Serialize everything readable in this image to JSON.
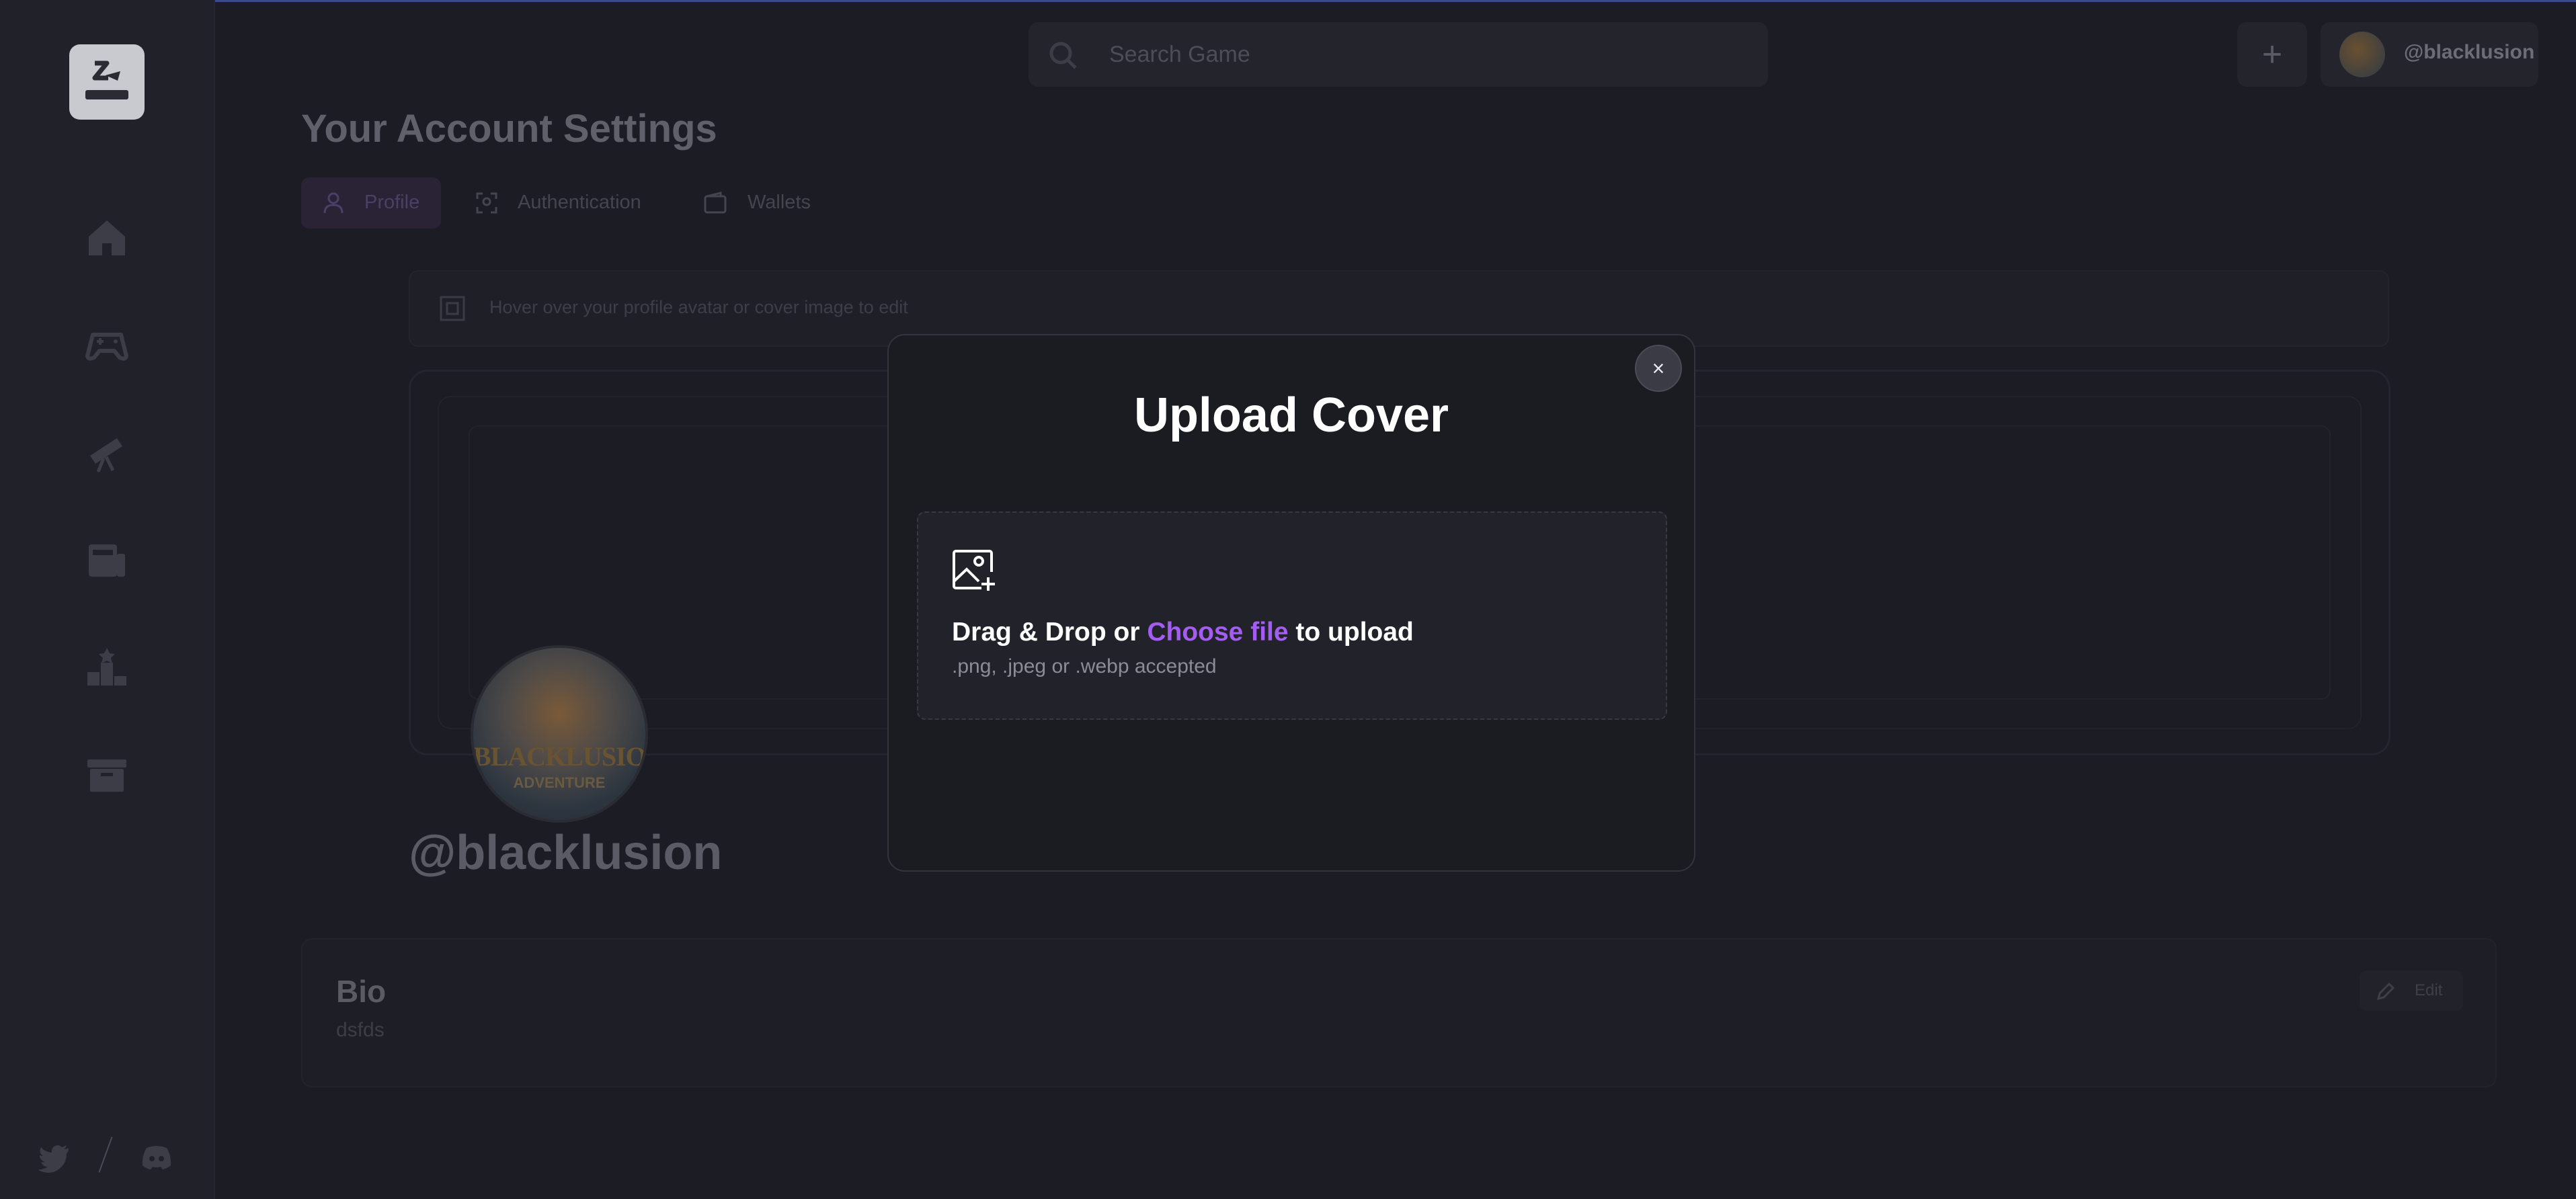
{
  "header": {
    "search_placeholder": "Search Game",
    "add_label": "+",
    "username": "@blacklusion"
  },
  "page": {
    "title": "Your Account Settings",
    "tabs": [
      {
        "label": "Profile",
        "active": true
      },
      {
        "label": "Authentication",
        "active": false
      },
      {
        "label": "Wallets",
        "active": false
      }
    ],
    "hint": "Hover over your profile avatar or cover image to edit",
    "avatar_brand": "BLACKLUSION",
    "avatar_sub": "ADVENTURE",
    "profile_name": "@blacklusion",
    "bio": {
      "heading": "Bio",
      "value": "dsfds",
      "edit_label": "Edit"
    }
  },
  "modal": {
    "title": "Upload Cover",
    "close_label": "×",
    "drop_prefix": "Drag & Drop or ",
    "drop_link": "Choose file",
    "drop_suffix": " to upload",
    "accepted": ".png, .jpeg or .webp accepted"
  },
  "sidebar": {
    "icons": [
      "home-icon",
      "gamepad-icon",
      "telescope-icon",
      "news-icon",
      "leaderboard-icon",
      "archive-icon"
    ],
    "social": [
      "twitter-icon",
      "discord-icon"
    ]
  },
  "colors": {
    "accent": "#a45cf2",
    "background": "#1c1d24",
    "modal": "#1b1c22"
  }
}
